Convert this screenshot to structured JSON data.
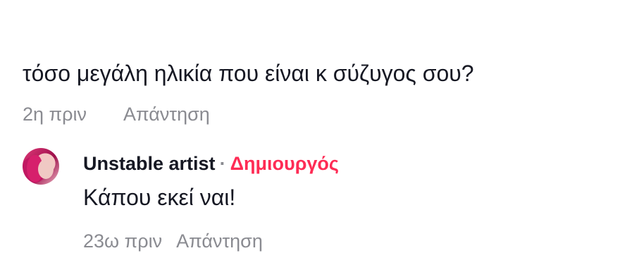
{
  "comment": {
    "text": "τόσο μεγάλη ηλικία που είναι κ σύζυγος σου?",
    "time": "2η πριν",
    "reply_label": "Απάντηση"
  },
  "reply": {
    "avatar_icon": "user-avatar",
    "author": "Unstable artist",
    "separator": "·",
    "badge": "Δημιουργός",
    "text": "Κάπου εκεί ναι!",
    "time": "23ω πριν",
    "reply_label": "Απάντηση"
  },
  "colors": {
    "text": "#161823",
    "muted": "#8a8b91",
    "creator": "#fe2c55"
  }
}
